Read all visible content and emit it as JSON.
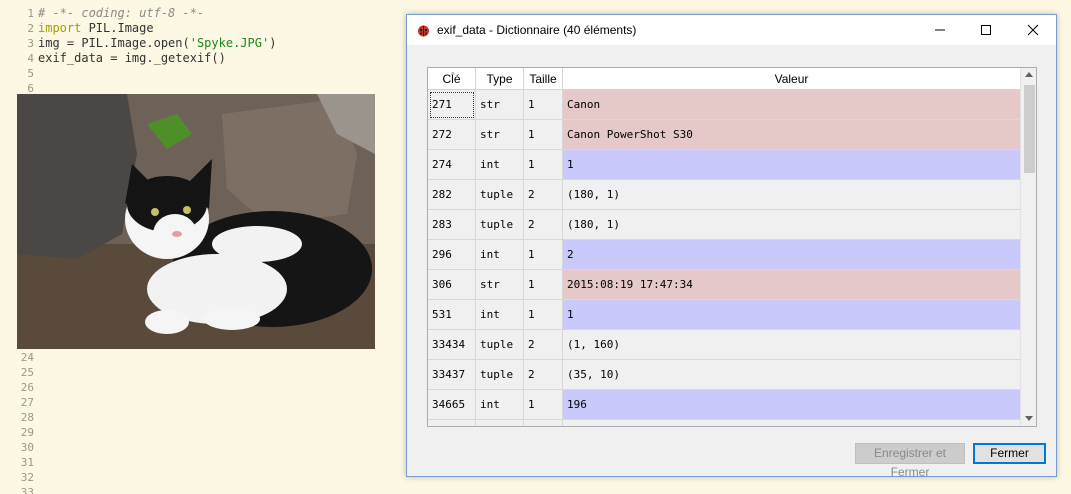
{
  "editor": {
    "lines": [
      {
        "n": "1",
        "parts": [
          {
            "t": "# -*- coding: utf-8 -*-",
            "c": "comment"
          }
        ]
      },
      {
        "n": "2",
        "parts": [
          {
            "t": "import",
            "c": "kw"
          },
          {
            "t": " PIL.Image",
            "c": ""
          }
        ]
      },
      {
        "n": "3",
        "parts": [
          {
            "t": "img = PIL.Image.open(",
            "c": ""
          },
          {
            "t": "'Spyke.JPG'",
            "c": "str"
          },
          {
            "t": ")",
            "c": ""
          }
        ]
      },
      {
        "n": "4",
        "parts": [
          {
            "t": "exif_data = img._getexif()",
            "c": ""
          }
        ]
      },
      {
        "n": "5",
        "parts": []
      },
      {
        "n": "6",
        "parts": []
      }
    ],
    "lower_line_numbers": [
      "24",
      "25",
      "26",
      "27",
      "28",
      "29",
      "30",
      "31",
      "32",
      "33"
    ]
  },
  "dialog": {
    "title": "exif_data - Dictionnaire (40 éléments)",
    "columns": [
      "Clé",
      "Type",
      "Taille",
      "Valeur"
    ],
    "rows": [
      {
        "key": "271",
        "type": "str",
        "size": "1",
        "value": "Canon",
        "color": "#e5c8c8"
      },
      {
        "key": "272",
        "type": "str",
        "size": "1",
        "value": "Canon PowerShot S30",
        "color": "#e5c8c8"
      },
      {
        "key": "274",
        "type": "int",
        "size": "1",
        "value": "1",
        "color": "#c9c9fb"
      },
      {
        "key": "282",
        "type": "tuple",
        "size": "2",
        "value": "(180, 1)",
        "color": "#f0f0f0"
      },
      {
        "key": "283",
        "type": "tuple",
        "size": "2",
        "value": "(180, 1)",
        "color": "#f0f0f0"
      },
      {
        "key": "296",
        "type": "int",
        "size": "1",
        "value": "2",
        "color": "#c9c9fb"
      },
      {
        "key": "306",
        "type": "str",
        "size": "1",
        "value": "2015:08:19 17:47:34",
        "color": "#e5c8c8"
      },
      {
        "key": "531",
        "type": "int",
        "size": "1",
        "value": "1",
        "color": "#c9c9fb"
      },
      {
        "key": "33434",
        "type": "tuple",
        "size": "2",
        "value": "(1, 160)",
        "color": "#f0f0f0"
      },
      {
        "key": "33437",
        "type": "tuple",
        "size": "2",
        "value": "(35, 10)",
        "color": "#f0f0f0"
      },
      {
        "key": "34665",
        "type": "int",
        "size": "1",
        "value": "196",
        "color": "#c9c9fb"
      },
      {
        "key": "",
        "type": "",
        "size": "",
        "value": "",
        "color": "#f0f0f0"
      }
    ],
    "buttons": {
      "save_close": "Enregistrer et Fermer",
      "close": "Fermer"
    }
  }
}
